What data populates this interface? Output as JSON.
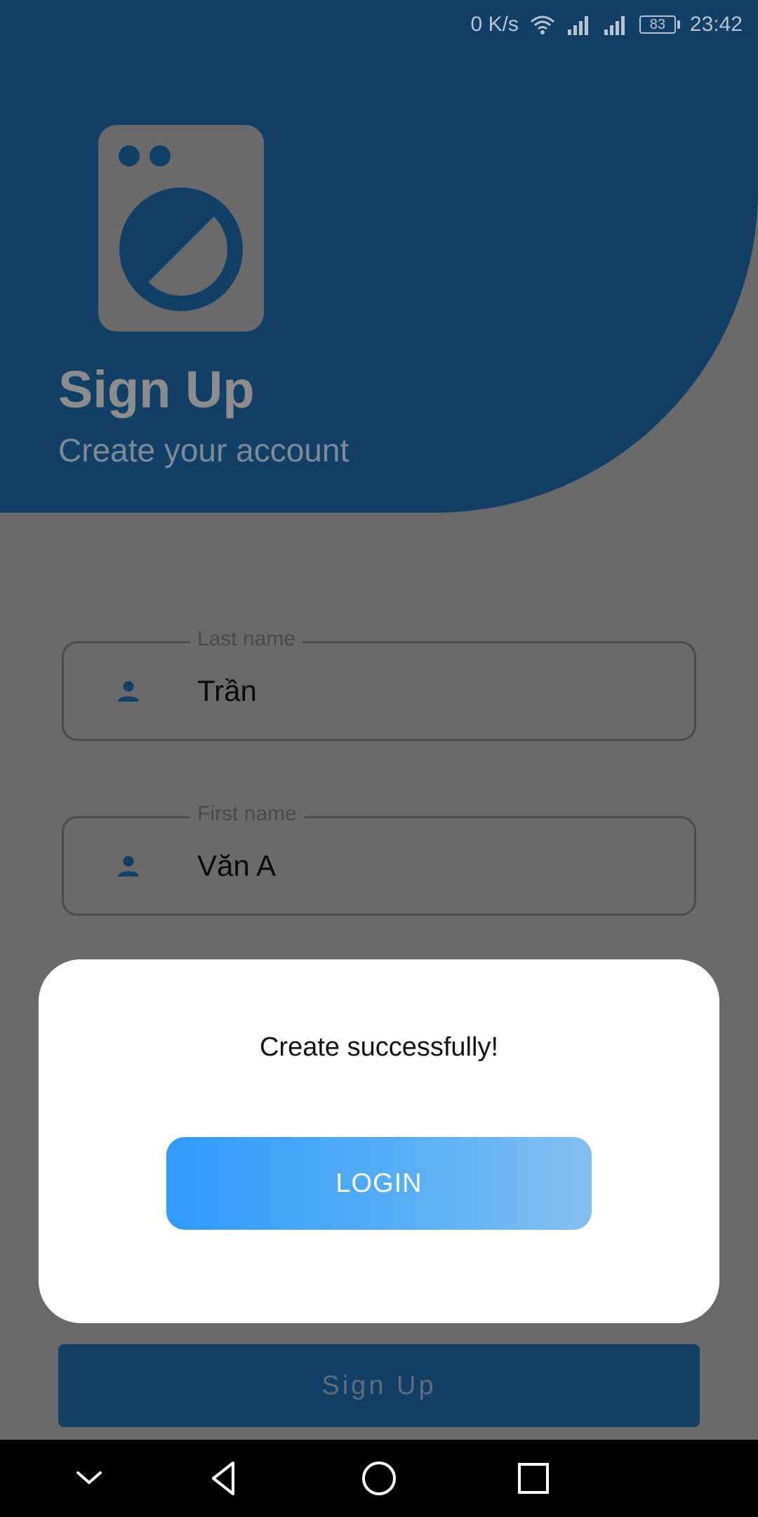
{
  "status_bar": {
    "speed": "0 K/s",
    "battery": "83",
    "time": "23:42"
  },
  "header": {
    "title": "Sign Up",
    "subtitle": "Create your account"
  },
  "form": {
    "last_name": {
      "label": "Last name",
      "value": "Trần"
    },
    "first_name": {
      "label": "First name",
      "value": "Văn A"
    },
    "signup_label": "Sign Up"
  },
  "dialog": {
    "message": "Create successfully!",
    "login_label": "LOGIN"
  },
  "colors": {
    "primary": "#1976d2",
    "accent": "#2f9bfb"
  },
  "icons": {
    "nav": [
      "chevron-down-icon",
      "back-icon",
      "home-icon",
      "recents-icon"
    ],
    "field": "person-icon"
  }
}
